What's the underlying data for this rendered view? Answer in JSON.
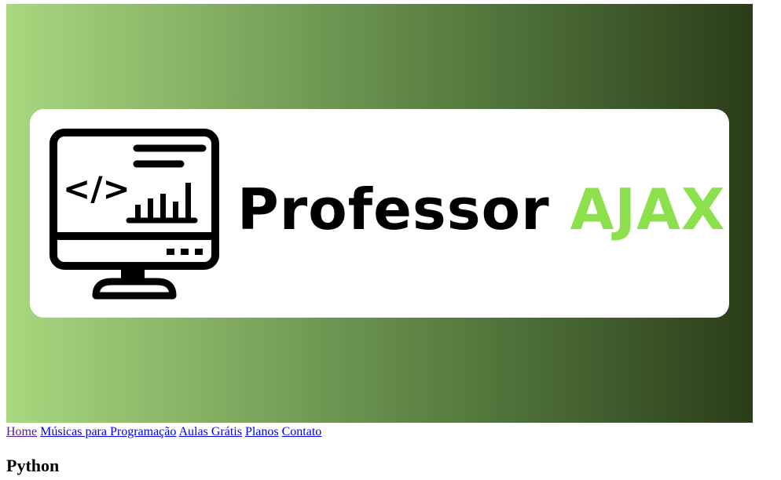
{
  "banner": {
    "logo": {
      "word1": "Professor",
      "word2": "AJAX",
      "icon": "monitor-code-chart-icon",
      "code_glyph": "</>",
      "word2_color": "#8be04b"
    },
    "gradient": [
      "#a8d87f",
      "#2a3d19"
    ]
  },
  "nav": {
    "items": [
      {
        "label": "Home"
      },
      {
        "label": "Músicas para Programação"
      },
      {
        "label": "Aulas Grátis"
      },
      {
        "label": "Planos"
      },
      {
        "label": "Contato"
      }
    ]
  },
  "main": {
    "heading": "Python"
  }
}
